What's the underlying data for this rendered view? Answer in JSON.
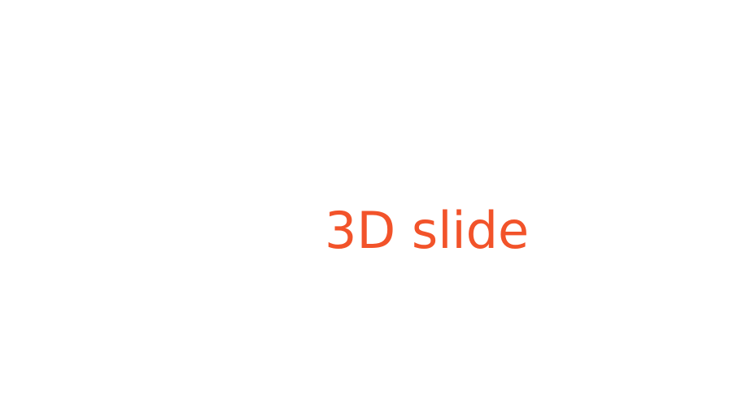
{
  "slide": {
    "title": "3D slide",
    "title_color": "#f2532a",
    "background_color": "#ffffff"
  }
}
